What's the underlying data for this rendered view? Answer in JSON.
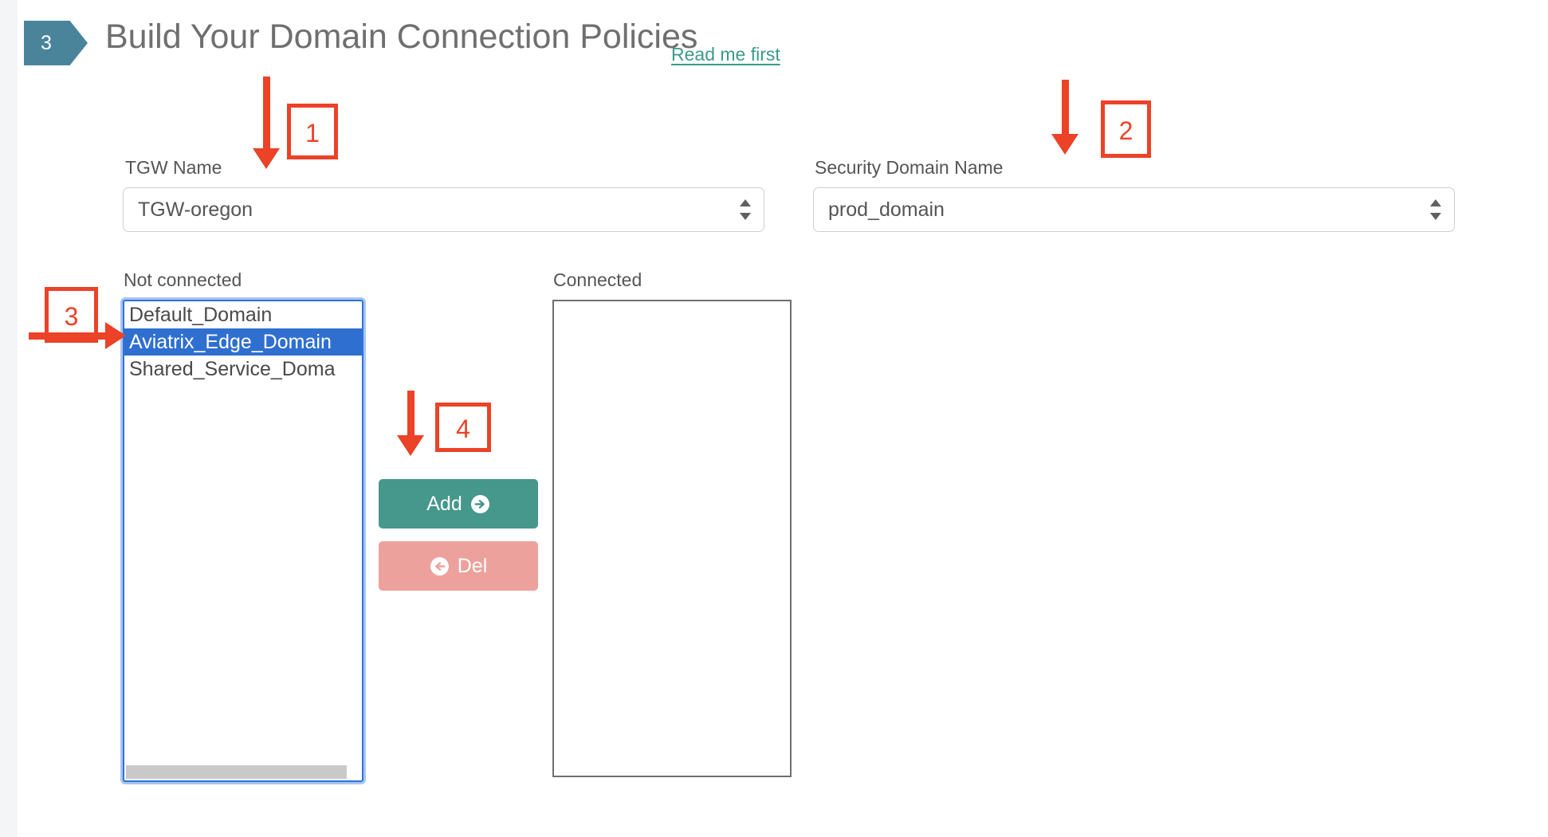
{
  "header": {
    "step_number": "3",
    "title": "Build Your Domain Connection Policies",
    "read_me_link": "Read me first"
  },
  "form": {
    "tgw": {
      "label": "TGW Name",
      "selected": "TGW-oregon"
    },
    "security_domain": {
      "label": "Security Domain Name",
      "selected": "prod_domain"
    }
  },
  "lists": {
    "not_connected": {
      "label": "Not connected",
      "options": [
        {
          "text": "Default_Domain",
          "selected": false
        },
        {
          "text": "Aviatrix_Edge_Domain",
          "selected": true
        },
        {
          "text": "Shared_Service_Doma",
          "selected": false
        }
      ]
    },
    "connected": {
      "label": "Connected",
      "options": []
    }
  },
  "buttons": {
    "add": {
      "label": "Add",
      "icon": "arrow-circle-right-icon",
      "color": "#46978c"
    },
    "del": {
      "label": "Del",
      "icon": "arrow-circle-left-icon",
      "color": "#eda19c"
    }
  },
  "annotations": {
    "color": "#eb4228",
    "markers": [
      {
        "id": "1",
        "label": "1",
        "points_to": "tgw-name-select"
      },
      {
        "id": "2",
        "label": "2",
        "points_to": "security-domain-name-select"
      },
      {
        "id": "3",
        "label": "3",
        "points_to": "not-connected-list"
      },
      {
        "id": "4",
        "label": "4",
        "points_to": "add-button"
      }
    ]
  },
  "theme": {
    "badge_color": "#4a849a",
    "link_color": "#3a9b8a",
    "selection_color": "#2f6fd0",
    "focus_ring_color": "#2f73d8"
  }
}
